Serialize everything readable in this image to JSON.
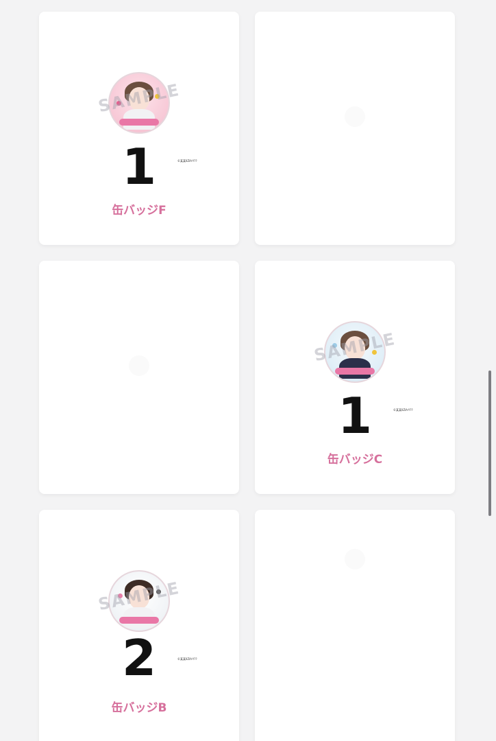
{
  "watermark_text": "SAMPLE",
  "items": [
    {
      "name": "缶バッジF",
      "quantity": "1",
      "copyright": "©某某IIZIA-Y??"
    },
    {
      "name": "",
      "quantity": ""
    },
    {
      "name": "",
      "quantity": ""
    },
    {
      "name": "缶バッジC",
      "quantity": "1",
      "copyright": "©某某IIZIA-Y??"
    },
    {
      "name": "缶バッジB",
      "quantity": "2",
      "copyright": "©某某IIZIA-Y??"
    },
    {
      "name": "",
      "quantity": ""
    }
  ],
  "colors": {
    "label": "#d6709c",
    "quantity": "#111111",
    "background": "#f3f3f4",
    "card": "#ffffff"
  }
}
